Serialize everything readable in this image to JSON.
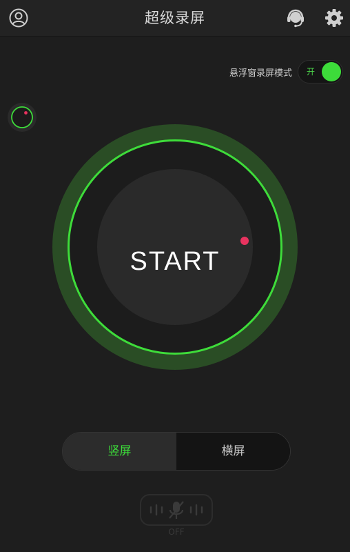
{
  "header": {
    "title": "超级录屏",
    "icons": {
      "profile": "user-circle-icon",
      "support": "headset-icon",
      "settings": "gear-icon"
    }
  },
  "floating_mode": {
    "label": "悬浮窗录屏模式",
    "toggle_text": "开",
    "enabled": true
  },
  "record": {
    "label": "START"
  },
  "orientation": {
    "options": [
      "竖屏",
      "横屏"
    ],
    "selected": "竖屏"
  },
  "mic": {
    "state_label": "OFF",
    "icon": "microphone-muted-icon"
  },
  "colors": {
    "accent": "#3ddc3a",
    "ring": "#2a4d25",
    "record_dot": "#e8335f",
    "background": "#1e1e1e"
  }
}
